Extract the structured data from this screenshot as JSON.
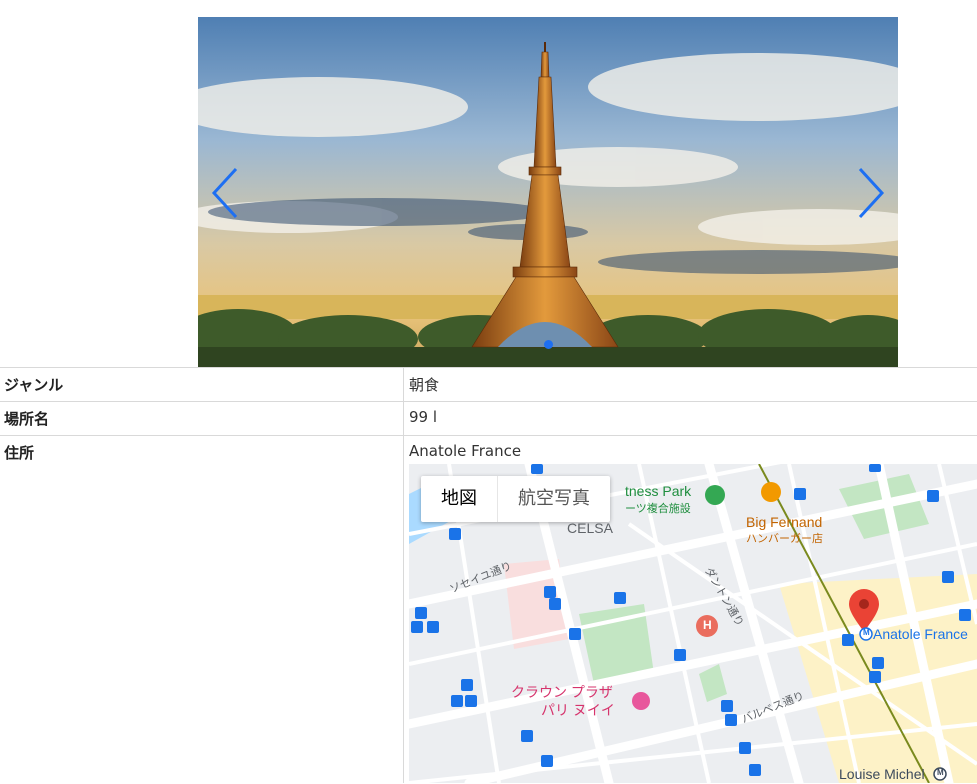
{
  "carousel": {
    "image_alt": "Eiffel Tower",
    "prev_icon": "chevron-left-icon",
    "next_icon": "chevron-right-icon",
    "accent": "#1d6ff2",
    "active_dot_color": "#1d6ff2"
  },
  "details": {
    "rows": [
      {
        "label": "ジャンル",
        "value": "朝食"
      },
      {
        "label": "場所名",
        "value": "99 l"
      },
      {
        "label": "住所",
        "value": "Anatole France"
      }
    ]
  },
  "map": {
    "toggle": {
      "map_label": "地図",
      "satellite_label": "航空写真"
    },
    "labels": {
      "fitness": "tness Park",
      "fitness_sub": "ーツ複合施設",
      "celsa": "CELSA",
      "big_fernand": "Big Fernand",
      "big_fernand_sub": "ハンバーガー店",
      "danton": "ダントン通り",
      "seine": "ソセイユ通り",
      "crown_plaza_1": "クラウン プラザ",
      "crown_plaza_2": "パリ ヌイイ",
      "anatole": "Anatole France",
      "louise": "Louise Michel",
      "barbes": "バルベス通り",
      "metro_sym": "M",
      "hospital_sym": "H"
    },
    "colors": {
      "water": "#aadaff",
      "park": "#c3e6c3",
      "highlight": "#fdf2c7",
      "pink": "#f9dede",
      "pin": "#ea4335",
      "metro_line": "#7a8a1e"
    }
  }
}
